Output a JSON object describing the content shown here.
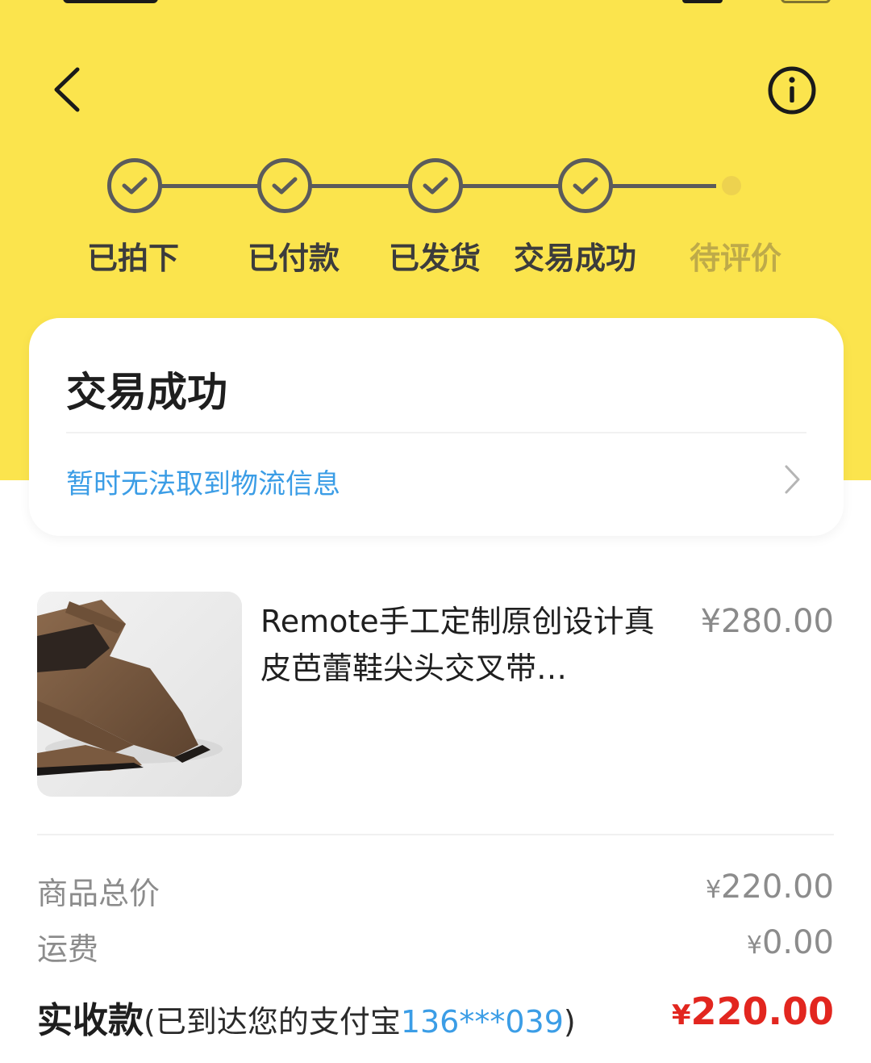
{
  "steps": [
    {
      "label": "已拍下"
    },
    {
      "label": "已付款"
    },
    {
      "label": "已发货"
    },
    {
      "label": "交易成功"
    },
    {
      "label": "待评价"
    }
  ],
  "status": {
    "title": "交易成功",
    "logistics": "暂时无法取到物流信息"
  },
  "product": {
    "title": "Remote手工定制原创设计真皮芭蕾鞋尖头交叉带…",
    "price_symbol": "¥",
    "price": "280.00"
  },
  "summary": {
    "goods_total_label": "商品总价",
    "goods_total_symbol": "¥",
    "goods_total": "220.00",
    "shipping_label": "运费",
    "shipping_symbol": "¥",
    "shipping": "0.00",
    "paid_label": "实收款",
    "paid_note_prefix": "(已到达您的支付宝",
    "paid_account": "136***039",
    "paid_note_suffix": ")",
    "paid_symbol": "¥",
    "paid": "220.00"
  },
  "icons": {
    "back": "chevron-left-icon",
    "info": "info-icon",
    "step": "check-icon",
    "logistics": "chevron-right-icon"
  },
  "colors": {
    "header_bg": "#FBE44D",
    "link": "#3B9DE6",
    "amount": "#E2261F"
  }
}
